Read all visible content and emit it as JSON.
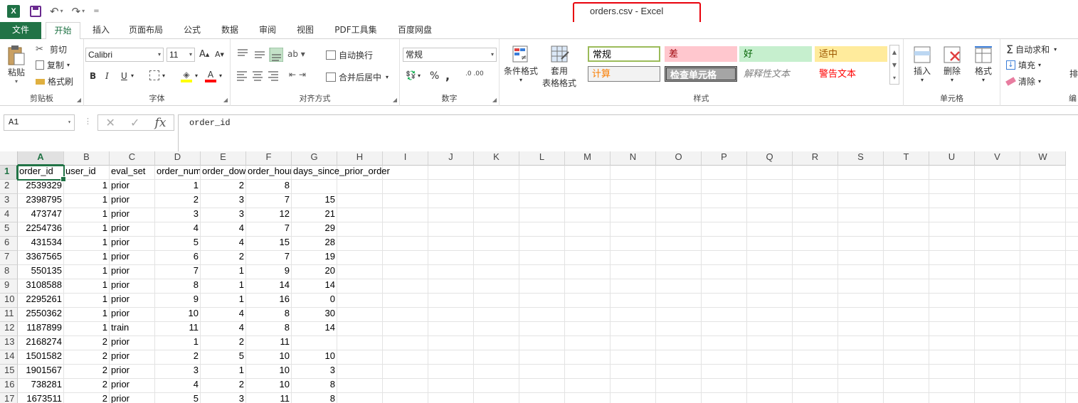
{
  "title": "orders.csv - Excel",
  "qat": {
    "logo": "X",
    "undo": "↶",
    "redo": "↷",
    "customize": "="
  },
  "tabs": [
    "文件",
    "开始",
    "插入",
    "页面布局",
    "公式",
    "数据",
    "审阅",
    "视图",
    "PDF工具集",
    "百度网盘"
  ],
  "ribbon": {
    "clipboard": {
      "paste": "粘贴",
      "cut": "剪切",
      "copy": "复制",
      "format_painter": "格式刷",
      "label": "剪贴板"
    },
    "font": {
      "name": "Calibri",
      "size": "11",
      "grow": "A",
      "shrink": "A",
      "bold": "B",
      "italic": "I",
      "underline": "U",
      "label": "字体"
    },
    "alignment": {
      "wrap": "自动换行",
      "merge": "合并后居中",
      "label": "对齐方式"
    },
    "number": {
      "format": "常规",
      "percent": "%",
      "comma": ",",
      "label": "数字"
    },
    "styles": {
      "conditional": "条件格式",
      "table_format_1": "套用",
      "table_format_2": "表格格式",
      "cells": [
        {
          "text": "常规",
          "bg": "#ffffff",
          "color": "#000000",
          "border": "#9bbb59"
        },
        {
          "text": "差",
          "bg": "#ffc7ce",
          "color": "#9c0006",
          "border": "#ffc7ce"
        },
        {
          "text": "好",
          "bg": "#c6efce",
          "color": "#006100",
          "border": "#c6efce"
        },
        {
          "text": "适中",
          "bg": "#ffeb9c",
          "color": "#9c5700",
          "border": "#ffeb9c"
        },
        {
          "text": "计算",
          "bg": "#f2f2f2",
          "color": "#fa7d00",
          "border": "#7f7f7f"
        },
        {
          "text": "检查单元格",
          "bg": "#a5a5a5",
          "color": "#ffffff",
          "border": "#3f3f3f"
        },
        {
          "text": "解释性文本",
          "bg": "#ffffff",
          "color": "#7f7f7f",
          "border": "#ffffff"
        },
        {
          "text": "警告文本",
          "bg": "#ffffff",
          "color": "#ff0000",
          "border": "#ffffff"
        }
      ],
      "label": "样式"
    },
    "cells_group": {
      "insert": "插入",
      "delete": "删除",
      "format": "格式",
      "label": "单元格"
    },
    "editing": {
      "autosum": "自动求和",
      "fill": "填充",
      "clear": "清除",
      "sort": "排"
    }
  },
  "formula_bar": {
    "name_box": "A1",
    "cancel": "✕",
    "enter": "✓",
    "fx": "fx",
    "content": "order_id"
  },
  "columns": [
    "A",
    "B",
    "C",
    "D",
    "E",
    "F",
    "G",
    "H",
    "I",
    "J",
    "K",
    "L",
    "M",
    "N",
    "O",
    "P",
    "Q",
    "R",
    "S",
    "T",
    "U",
    "V",
    "W"
  ],
  "rows": [
    [
      "order_id",
      "user_id",
      "eval_set",
      "order_number",
      "order_dow",
      "order_hour_of_day",
      "days_since_prior_order"
    ],
    [
      "2539329",
      "1",
      "prior",
      "1",
      "2",
      "8",
      ""
    ],
    [
      "2398795",
      "1",
      "prior",
      "2",
      "3",
      "7",
      "15"
    ],
    [
      "473747",
      "1",
      "prior",
      "3",
      "3",
      "12",
      "21"
    ],
    [
      "2254736",
      "1",
      "prior",
      "4",
      "4",
      "7",
      "29"
    ],
    [
      "431534",
      "1",
      "prior",
      "5",
      "4",
      "15",
      "28"
    ],
    [
      "3367565",
      "1",
      "prior",
      "6",
      "2",
      "7",
      "19"
    ],
    [
      "550135",
      "1",
      "prior",
      "7",
      "1",
      "9",
      "20"
    ],
    [
      "3108588",
      "1",
      "prior",
      "8",
      "1",
      "14",
      "14"
    ],
    [
      "2295261",
      "1",
      "prior",
      "9",
      "1",
      "16",
      "0"
    ],
    [
      "2550362",
      "1",
      "prior",
      "10",
      "4",
      "8",
      "30"
    ],
    [
      "1187899",
      "1",
      "train",
      "11",
      "4",
      "8",
      "14"
    ],
    [
      "2168274",
      "2",
      "prior",
      "1",
      "2",
      "11",
      ""
    ],
    [
      "1501582",
      "2",
      "prior",
      "2",
      "5",
      "10",
      "10"
    ],
    [
      "1901567",
      "2",
      "prior",
      "3",
      "1",
      "10",
      "3"
    ],
    [
      "738281",
      "2",
      "prior",
      "4",
      "2",
      "10",
      "8"
    ],
    [
      "1673511",
      "2",
      "prior",
      "5",
      "3",
      "11",
      "8"
    ]
  ]
}
